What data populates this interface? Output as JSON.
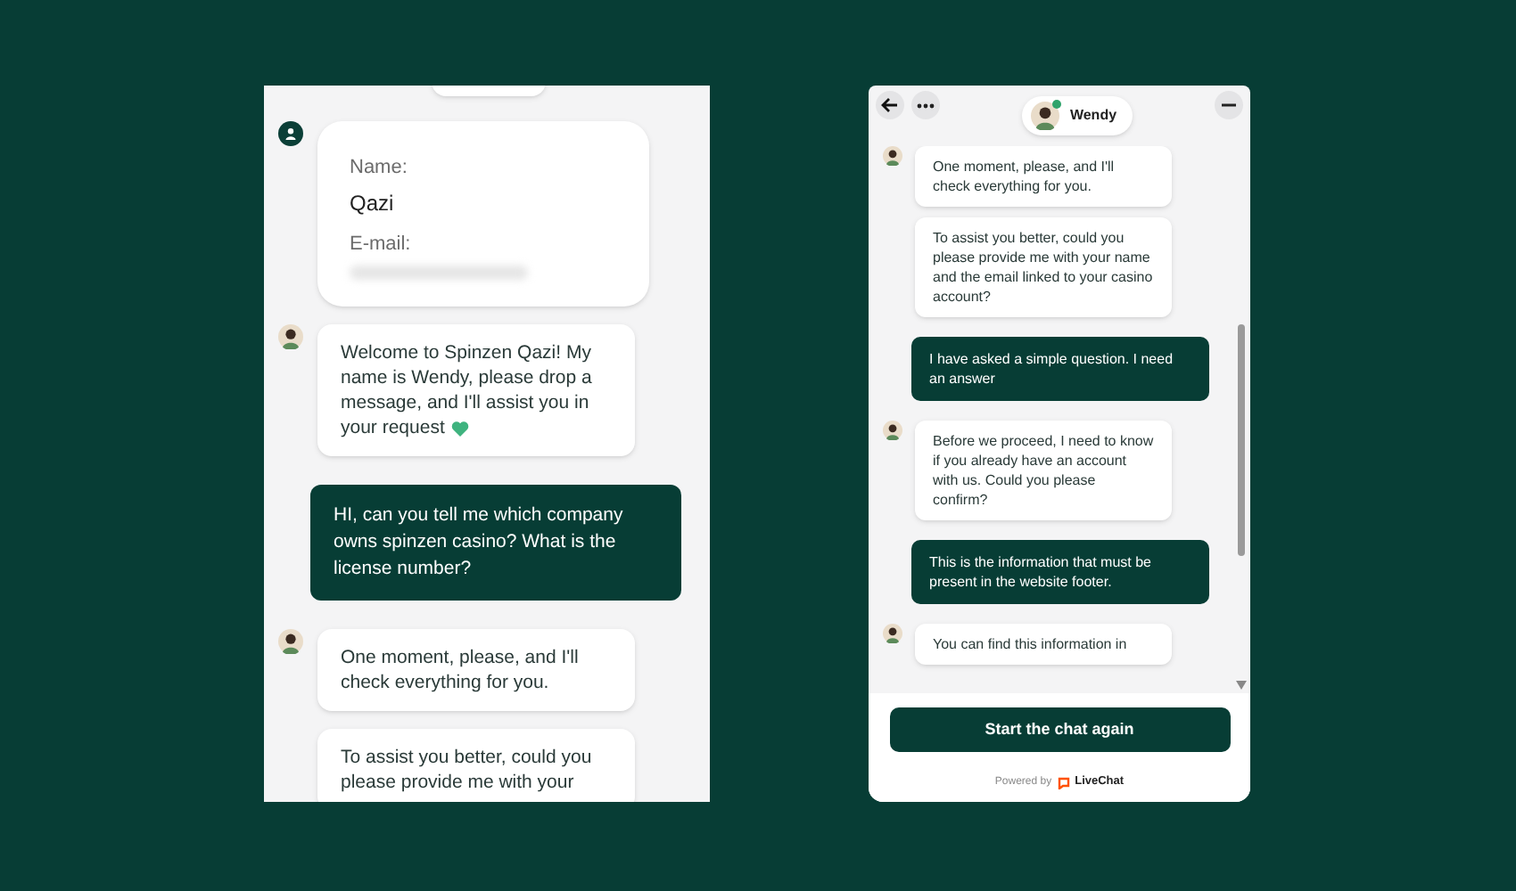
{
  "left_panel": {
    "messages": [
      {
        "kind": "form",
        "fields": [
          {
            "label": "Name:",
            "value": "Qazi"
          },
          {
            "label": "E-mail:",
            "redacted": true
          }
        ]
      },
      {
        "kind": "agent",
        "avatar": true,
        "text": "Welcome to Spinzen Qazi! My name is Wendy, please drop a message, and I'll assist you in your request",
        "heart": true
      },
      {
        "kind": "user",
        "text": "HI, can you tell me which company owns spinzen casino? What is the license number?"
      },
      {
        "kind": "agent",
        "avatar": true,
        "text": "One moment, please, and I'll check everything for you."
      },
      {
        "kind": "agent",
        "avatar": false,
        "text": "To assist you better, could you please provide me with your"
      }
    ]
  },
  "right_panel": {
    "header": {
      "agent_name": "Wendy",
      "online": true
    },
    "messages": [
      {
        "kind": "agent",
        "avatar": true,
        "text": "One moment, please, and I'll check everything for you."
      },
      {
        "kind": "agent",
        "avatar": false,
        "text": "To assist you better, could you please provide me with your name and the email linked to your casino account?"
      },
      {
        "kind": "user",
        "text": "I have asked a simple question. I need an answer"
      },
      {
        "kind": "agent",
        "avatar": true,
        "text": "Before we proceed, I need to know if you already have an account with us. Could you please confirm?"
      },
      {
        "kind": "user",
        "text": "This is the information that must be present in the website footer."
      },
      {
        "kind": "agent",
        "avatar": true,
        "text": "You can find this information in"
      }
    ],
    "button": "Start the chat again",
    "powered_by": "Powered by",
    "brand": "LiveChat"
  }
}
